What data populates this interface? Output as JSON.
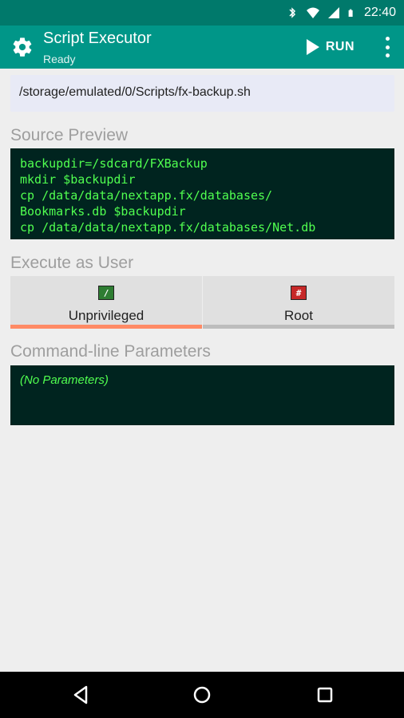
{
  "status_bar": {
    "time": "22:40",
    "icons": [
      "bluetooth-icon",
      "wifi-icon",
      "signal-icon",
      "battery-icon"
    ]
  },
  "app_bar": {
    "title": "Script Executor",
    "subtitle": "Ready",
    "run_label": "RUN",
    "icons": [
      "gear-icon",
      "play-icon",
      "overflow-menu-icon"
    ]
  },
  "script_path": "/storage/emulated/0/Scripts/fx-backup.sh",
  "source_preview": {
    "heading": "Source Preview",
    "lines": [
      "backupdir=/sdcard/FXBackup",
      "mkdir $backupdir",
      "cp /data/data/nextapp.fx/databases/",
      "Bookmarks.db $backupdir",
      "cp /data/data/nextapp.fx/databases/Net.db"
    ]
  },
  "execute_as": {
    "heading": "Execute as User",
    "options": [
      {
        "label": "Unprivileged",
        "badge": "/",
        "selected": true
      },
      {
        "label": "Root",
        "badge": "#",
        "selected": false
      }
    ]
  },
  "parameters": {
    "heading": "Command-line Parameters",
    "value": "(No Parameters)"
  },
  "colors": {
    "status_bar": "#00796b",
    "app_bar": "#009688",
    "console_bg": "#00241f",
    "console_text": "#50ff50",
    "selected_indicator": "#ff8a65"
  },
  "nav_bar": {
    "icons": [
      "back-icon",
      "home-icon",
      "recents-icon"
    ]
  }
}
